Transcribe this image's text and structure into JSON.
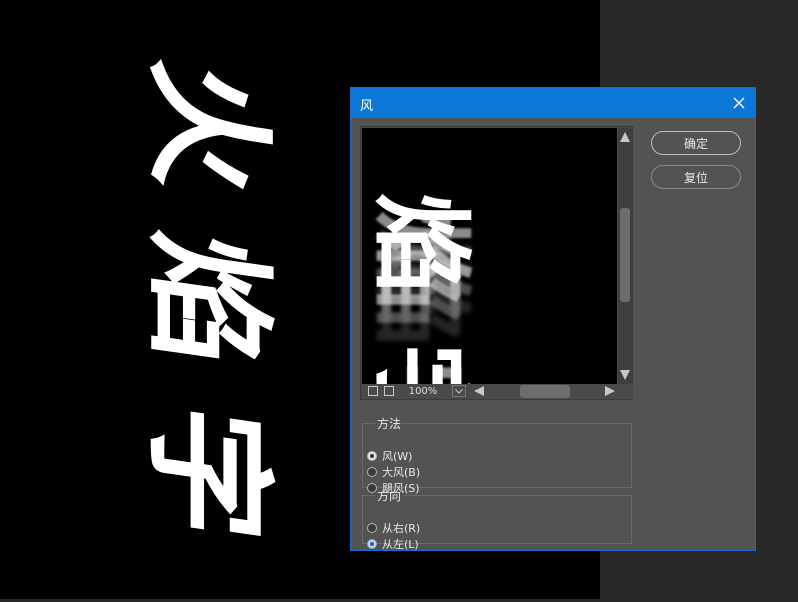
{
  "canvas": {
    "text_chars": [
      "火",
      "焰",
      "字"
    ]
  },
  "dialog": {
    "title": "风",
    "close_icon": "close-icon",
    "buttons": {
      "ok_label": "确定",
      "reset_label": "复位"
    },
    "preview": {
      "text_chars": [
        "焰",
        "字"
      ],
      "zoom": "100%"
    },
    "method": {
      "legend": "方法",
      "options": [
        "风(W)",
        "大风(B)",
        "飓风(S)"
      ],
      "selected": "风(W)"
    },
    "direction": {
      "legend": "方向",
      "options": [
        "从右(R)",
        "从左(L)"
      ],
      "selected": "从左(L)"
    }
  },
  "colors": {
    "titlebar": "#0b78d7",
    "dialog_bg": "#535353",
    "canvas_bg": "#000000",
    "workspace_bg": "#282828"
  }
}
